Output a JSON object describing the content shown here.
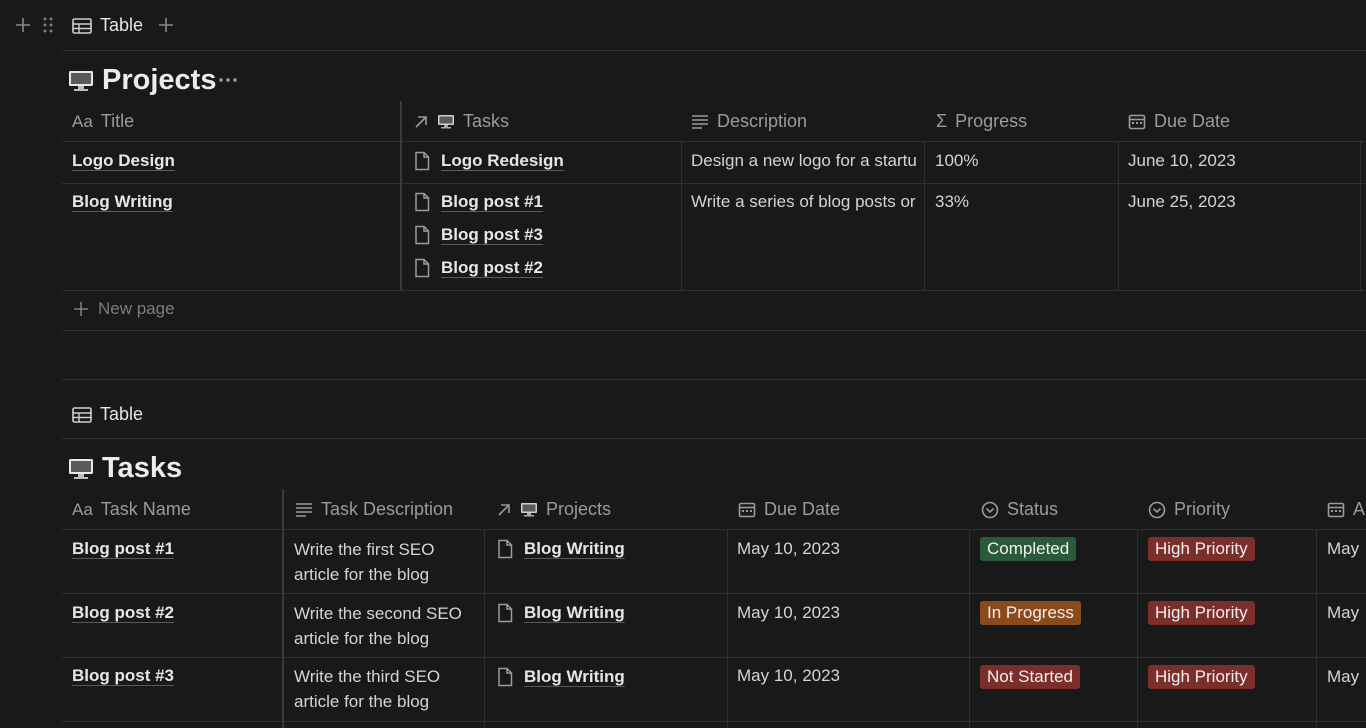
{
  "top_view": {
    "label": "Table"
  },
  "projects": {
    "title": "Projects",
    "columns": {
      "title": "Title",
      "tasks": "Tasks",
      "description": "Description",
      "progress": "Progress",
      "due": "Due Date"
    },
    "rows": [
      {
        "title": "Logo Design",
        "tasks": [
          "Logo Redesign"
        ],
        "description": "Design a new logo for a startu",
        "progress": "100%",
        "due": "June 10, 2023"
      },
      {
        "title": "Blog Writing",
        "tasks": [
          "Blog post #1",
          "Blog post #3",
          "Blog post #2"
        ],
        "description": "Write a series of blog posts or",
        "progress": "33%",
        "due": "June 25, 2023"
      }
    ],
    "new_page": "New page"
  },
  "tasks_view": {
    "label": "Table"
  },
  "tasks": {
    "title": "Tasks",
    "columns": {
      "name": "Task Name",
      "description": "Task Description",
      "projects": "Projects",
      "due": "Due Date",
      "status": "Status",
      "priority": "Priority",
      "extra": "A"
    },
    "rows": [
      {
        "name": "Blog post #1",
        "description": "Write the first SEO article for the blog",
        "project": "Blog Writing",
        "due": "May 10, 2023",
        "status": "Completed",
        "priority": "High Priority",
        "extra": "May"
      },
      {
        "name": "Blog post #2",
        "description": "Write the second SEO article for the blog",
        "project": "Blog Writing",
        "due": "May 10, 2023",
        "status": "In Progress",
        "priority": "High Priority",
        "extra": "May"
      },
      {
        "name": "Blog post #3",
        "description": "Write the third SEO article for the blog",
        "project": "Blog Writing",
        "due": "May 10, 2023",
        "status": "Not Started",
        "priority": "High Priority",
        "extra": "May"
      }
    ]
  },
  "colors": {
    "completed": "#2b5a3a",
    "in_progress": "#8a4a1c",
    "not_started": "#7a2f2a",
    "high_priority": "#7a2f2a"
  }
}
